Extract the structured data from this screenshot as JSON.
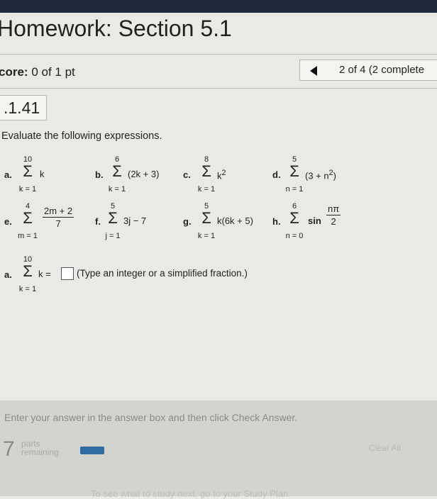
{
  "header": {
    "title": "Homework: Section 5.1"
  },
  "score": {
    "label": "core:",
    "value": "0 of 1 pt"
  },
  "progress": {
    "text": "2 of 4 (2 complete"
  },
  "question": {
    "number": ".1.41",
    "instructions": "Evaluate the following expressions."
  },
  "expressions": {
    "a": {
      "label": "a.",
      "upper": "10",
      "lower": "k = 1",
      "body": "k"
    },
    "b": {
      "label": "b.",
      "upper": "6",
      "lower": "k = 1",
      "body": "(2k + 3)"
    },
    "c": {
      "label": "c.",
      "upper": "8",
      "lower": "k = 1",
      "body": "k",
      "exponent": "2"
    },
    "d": {
      "label": "d.",
      "upper": "5",
      "lower": "n = 1",
      "body": "(3 + n",
      "exponent": "2",
      "tail": ")"
    },
    "e": {
      "label": "e.",
      "upper": "4",
      "lower": "m = 1",
      "numerator": "2m + 2",
      "denominator": "7"
    },
    "f": {
      "label": "f.",
      "upper": "5",
      "lower": "j = 1",
      "body": "3j − 7"
    },
    "g": {
      "label": "g.",
      "upper": "5",
      "lower": "k = 1",
      "body": "k(6k + 5)"
    },
    "h": {
      "label": "h.",
      "upper": "6",
      "lower": "n = 0",
      "func": "sin",
      "numerator": "nπ",
      "denominator": "2"
    }
  },
  "answer": {
    "label": "a.",
    "upper": "10",
    "lower": "k = 1",
    "body": "k =",
    "value": "",
    "hint": "(Type an integer or a simplified fraction.)"
  },
  "footer": {
    "instruction": "Enter your answer in the answer box and then click Check Answer.",
    "parts_count": "7",
    "parts_line1": "parts",
    "parts_line2": "remaining",
    "clear_label": "Clear All",
    "faded_text": "To see what to study next, go to your Study Plan."
  },
  "colors": {
    "accent": "#2f6ca1",
    "topbar": "#1d2b3c"
  },
  "icons": {
    "prev": "triangle-left-icon",
    "sigma": "sigma-icon"
  }
}
